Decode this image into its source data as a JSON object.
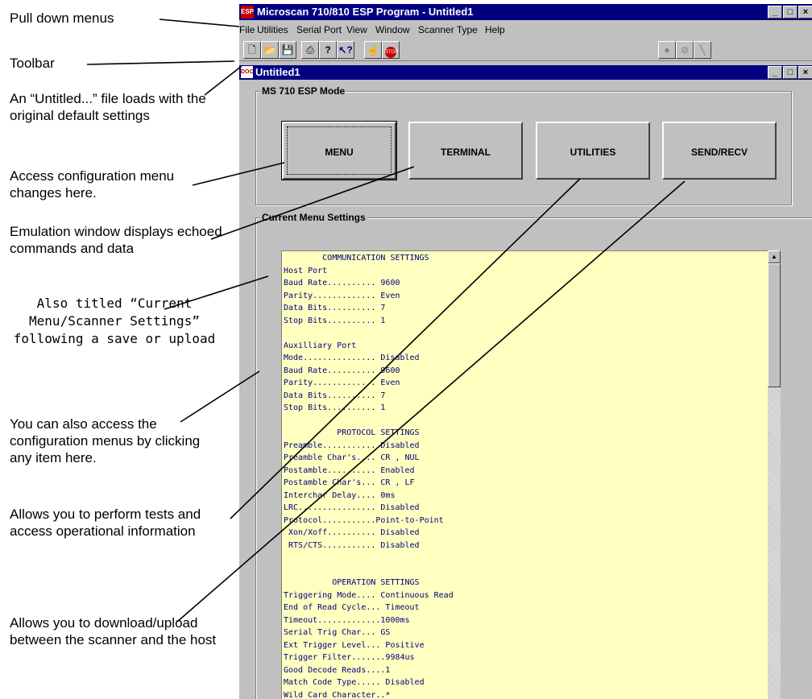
{
  "callouts": [
    "Pull down menus",
    "Toolbar",
    "An “Untitled...” file loads with the original default settings",
    "Access configuration menu changes here.",
    "Emulation window displays echoed commands and data",
    "Also titled “Current Menu/Scanner Settings” following a save or upload",
    "You can also access the configuration menus by clicking any item here.",
    "Allows you to perform tests and access operational information",
    "Allows you to download/upload between the scanner and the host"
  ],
  "app": {
    "title": "Microscan 710/810 ESP Program - Untitled1",
    "title_icon": "ESP",
    "window_buttons": [
      "_",
      "□",
      "×"
    ],
    "menus": [
      "File",
      "Utilities",
      "Serial Port",
      "View",
      "Window",
      "Scanner Type",
      "Help"
    ],
    "toolbar": {
      "left": [
        {
          "icon": "new-file-icon",
          "glyph": "🗋"
        },
        {
          "icon": "open-folder-icon",
          "glyph": "📂"
        },
        {
          "icon": "save-disk-icon",
          "glyph": "💾"
        },
        {
          "icon": "printer-icon",
          "glyph": "⎙"
        },
        {
          "icon": "help-icon",
          "glyph": "?"
        },
        {
          "icon": "context-help-icon",
          "glyph": "↖?"
        },
        {
          "icon": "trigger-icon",
          "glyph": "☝"
        },
        {
          "icon": "stop-icon",
          "glyph": "STOP"
        }
      ],
      "right": [
        {
          "icon": "record-icon",
          "glyph": "●"
        },
        {
          "icon": "stop-disabled-icon",
          "glyph": "⊘"
        },
        {
          "icon": "wand-icon",
          "glyph": "╲"
        }
      ]
    }
  },
  "child": {
    "title": "Untitled1",
    "title_icon": "DOC",
    "mode_label": "MS 710 ESP Mode",
    "buttons": [
      "MENU",
      "TERMINAL",
      "UTILITIES",
      "SEND/RECV"
    ],
    "settings_label": "Current Menu Settings",
    "settings_lines": [
      "        COMMUNICATION SETTINGS",
      "Host Port",
      "Baud Rate.......... 9600",
      "Parity............. Even",
      "Data Bits.......... 7",
      "Stop Bits.......... 1",
      "",
      "Auxilliary Port",
      "Mode............... Disabled",
      "Baud Rate.......... 9600",
      "Parity............. Even",
      "Data Bits.......... 7",
      "Stop Bits.......... 1",
      "",
      "           PROTOCOL SETTINGS",
      "Preamble........... Disabled",
      "Preamble Char's.... CR , NUL",
      "Postamble.......... Enabled",
      "Postamble Char's... CR , LF",
      "Interchar Delay.... 0ms",
      "LRC................ Disabled",
      "Protocol...........Point-to-Point",
      " Xon/Xoff.......... Disabled",
      " RTS/CTS........... Disabled",
      "",
      "",
      "          OPERATION SETTINGS",
      "Triggering Mode.... Continuous Read",
      "End of Read Cycle... Timeout",
      "Timeout.............1000ms",
      "Serial Trig Char... GS",
      "Ext Trigger Level... Positive",
      "Trigger Filter.......9984us",
      "Good Decode Reads....1",
      "Match Code Type..... Disabled",
      "Wild Card Character..*"
    ],
    "scroll_up": "▲"
  }
}
